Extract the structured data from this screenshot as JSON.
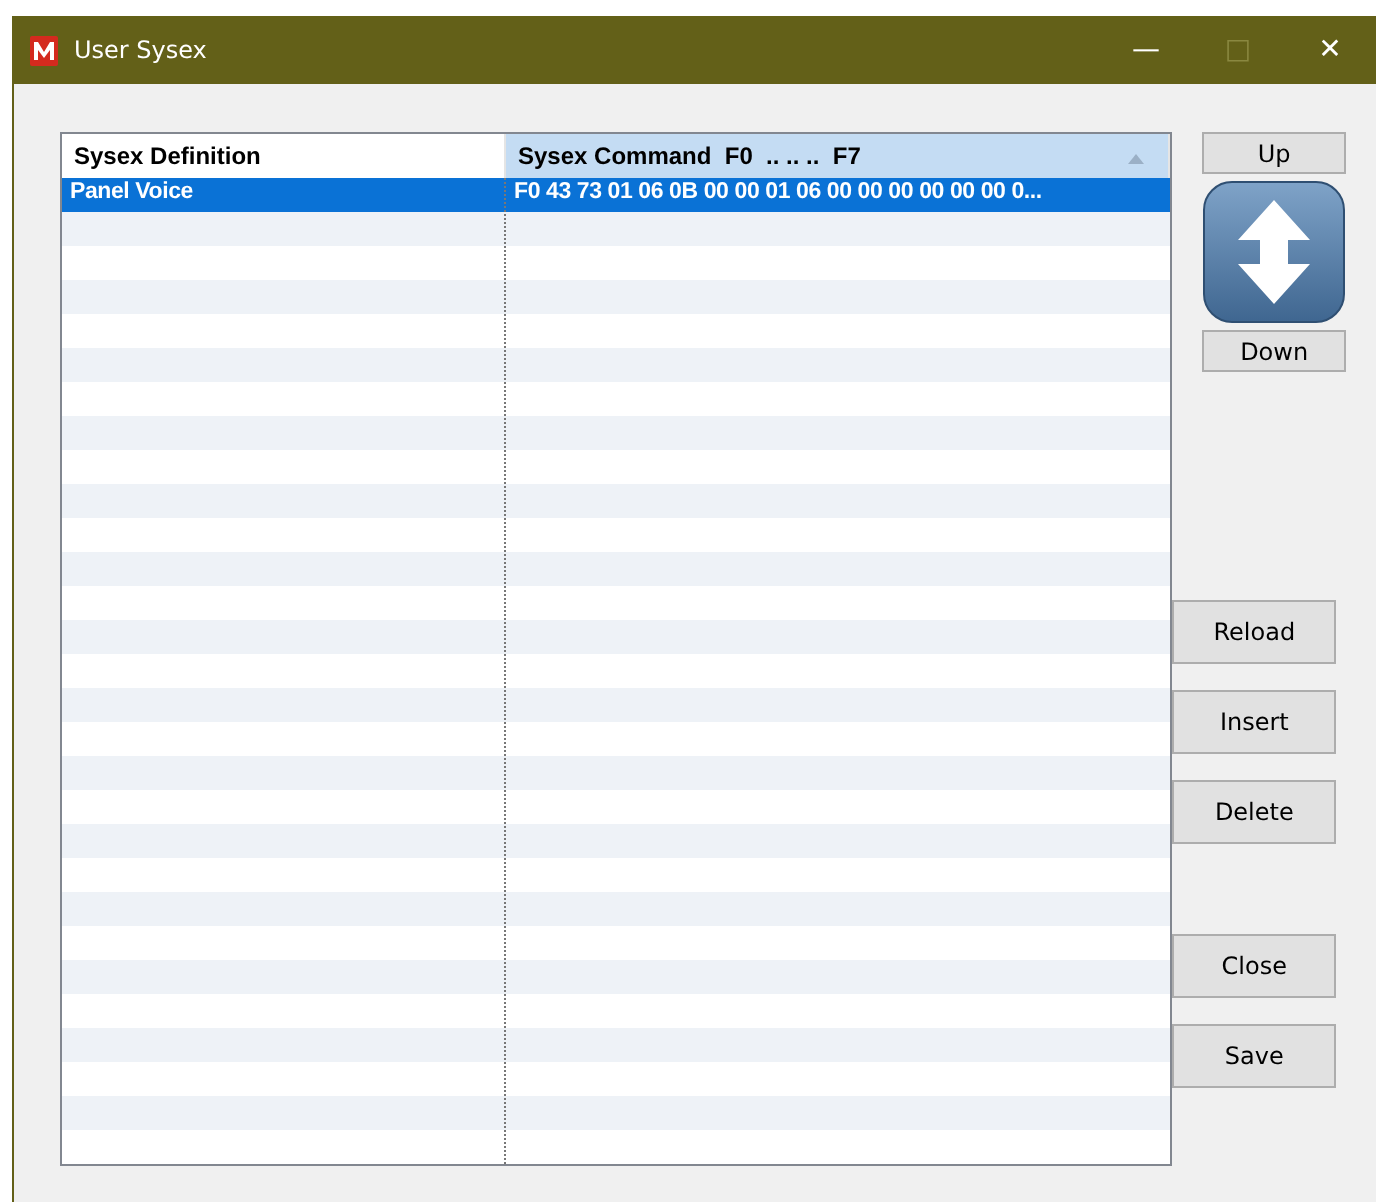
{
  "window": {
    "title": "User Sysex",
    "controls": {
      "minimize": "—",
      "maximize": "□",
      "close": "✕"
    }
  },
  "table": {
    "columns": [
      {
        "label": "Sysex Definition",
        "sorted": false
      },
      {
        "label": "Sysex Command  F0  .. .. ..  F7",
        "sorted": true
      }
    ],
    "rows": [
      {
        "cells": [
          "Panel Voice",
          "F0 43 73 01 06 0B 00 00 01 06 00 00 00 00 00 00 0..."
        ],
        "selected": true
      }
    ]
  },
  "move_buttons": {
    "up": "Up",
    "down": "Down"
  },
  "button_groups": [
    [
      {
        "label": "Reload"
      },
      {
        "label": "Insert"
      },
      {
        "label": "Delete"
      }
    ],
    [
      {
        "label": "Close"
      },
      {
        "label": "Save"
      }
    ]
  ]
}
